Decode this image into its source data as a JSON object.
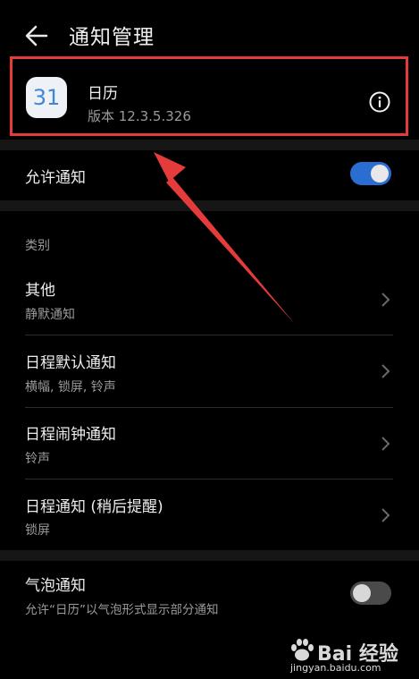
{
  "header": {
    "title": "通知管理"
  },
  "app": {
    "icon_text": "31",
    "name": "日历",
    "version": "版本 12.3.5.326"
  },
  "allow_notifications": {
    "label": "允许通知",
    "enabled": true
  },
  "category": {
    "label": "类别",
    "items": [
      {
        "title": "其他",
        "subtitle": "静默通知"
      },
      {
        "title": "日程默认通知",
        "subtitle": "横幅, 锁屏, 铃声"
      },
      {
        "title": "日程闹钟通知",
        "subtitle": "铃声"
      },
      {
        "title": "日程通知 (稍后提醒)",
        "subtitle": "锁屏"
      }
    ]
  },
  "bubble": {
    "title": "气泡通知",
    "subtitle": "允许“日历”以气泡形式显示部分通知",
    "enabled": false
  },
  "watermark": {
    "brand": "Bai 经验",
    "url": "jingyan.baidu.com"
  },
  "colors": {
    "accent": "#2b6ed3",
    "highlight": "#e63b3b",
    "background": "#000000"
  }
}
